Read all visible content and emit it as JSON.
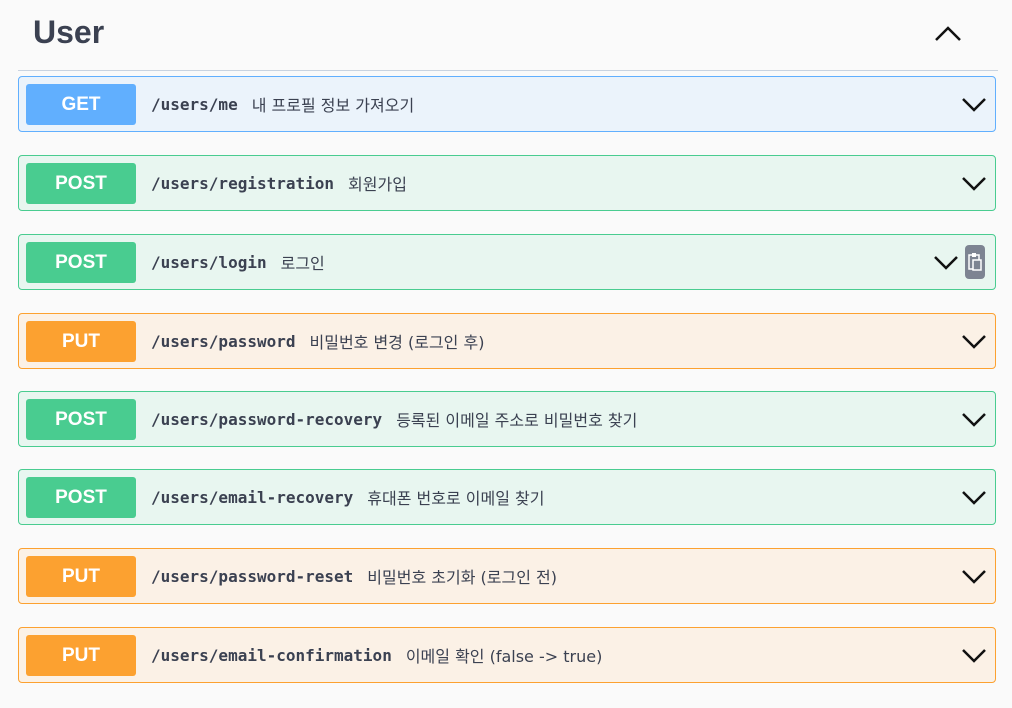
{
  "section": {
    "title": "User"
  },
  "colors": {
    "get": "#61affe",
    "post": "#49cc90",
    "put": "#fca130"
  },
  "operations": [
    {
      "method": "GET",
      "path": "/users/me",
      "summary": "내 프로필 정보 가져오기"
    },
    {
      "method": "POST",
      "path": "/users/registration",
      "summary": "회원가입"
    },
    {
      "method": "POST",
      "path": "/users/login",
      "summary": "로그인",
      "has_copy_icon": true
    },
    {
      "method": "PUT",
      "path": "/users/password",
      "summary": "비밀번호 변경 (로그인 후)"
    },
    {
      "method": "POST",
      "path": "/users/password-recovery",
      "summary": "등록된 이메일 주소로 비밀번호 찾기"
    },
    {
      "method": "POST",
      "path": "/users/email-recovery",
      "summary": "휴대폰 번호로 이메일 찾기"
    },
    {
      "method": "PUT",
      "path": "/users/password-reset",
      "summary": "비밀번호 초기화 (로그인 전)"
    },
    {
      "method": "PUT",
      "path": "/users/email-confirmation",
      "summary": "이메일 확인 (false -> true)"
    }
  ],
  "icons": {
    "collapse": "chevron-up-icon",
    "expand": "chevron-down-icon",
    "copy": "copy-icon"
  }
}
